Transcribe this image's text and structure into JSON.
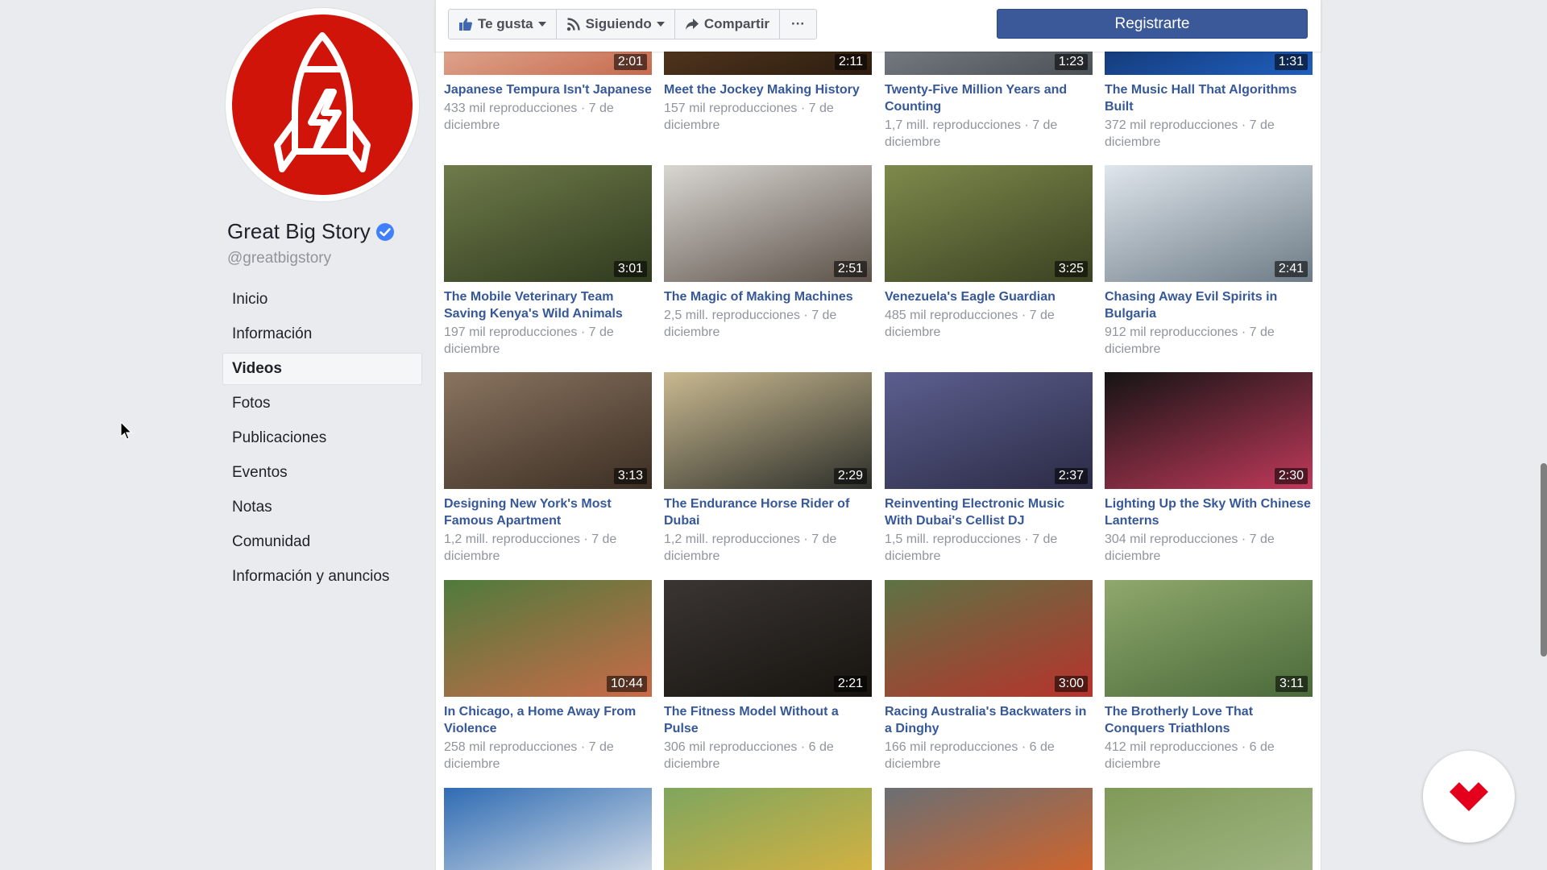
{
  "page": {
    "name": "Great Big Story",
    "handle": "@greatbigstory"
  },
  "nav": {
    "items": [
      {
        "label": "Inicio"
      },
      {
        "label": "Información"
      },
      {
        "label": "Videos",
        "active": true
      },
      {
        "label": "Fotos"
      },
      {
        "label": "Publicaciones"
      },
      {
        "label": "Eventos"
      },
      {
        "label": "Notas"
      },
      {
        "label": "Comunidad"
      },
      {
        "label": "Información y anuncios"
      }
    ]
  },
  "toolbar": {
    "like_label": "Te gusta",
    "following_label": "Siguiendo",
    "share_label": "Compartir",
    "more_label": "···",
    "register_label": "Registrarte"
  },
  "videos": [
    {
      "title": "Japanese Tempura Isn't Japanese",
      "views": "433 mil reproducciones · 7 de diciembre",
      "duration": "2:01"
    },
    {
      "title": "Meet the Jockey Making History",
      "views": "157 mil reproducciones · 7 de diciembre",
      "duration": "2:11"
    },
    {
      "title": "Twenty-Five Million Years and Counting",
      "views": "1,7 mill. reproducciones · 7 de diciembre",
      "duration": "1:23"
    },
    {
      "title": "The Music Hall That Algorithms Built",
      "views": "372 mil reproducciones · 7 de diciembre",
      "duration": "1:31"
    },
    {
      "title": "The Mobile Veterinary Team Saving Kenya's Wild Animals",
      "views": "197 mil reproducciones · 7 de diciembre",
      "duration": "3:01"
    },
    {
      "title": "The Magic of Making Machines",
      "views": "2,5 mill. reproducciones · 7 de diciembre",
      "duration": "2:51"
    },
    {
      "title": "Venezuela's Eagle Guardian",
      "views": "485 mil reproducciones · 7 de diciembre",
      "duration": "3:25"
    },
    {
      "title": "Chasing Away Evil Spirits in Bulgaria",
      "views": "912 mil reproducciones · 7 de diciembre",
      "duration": "2:41"
    },
    {
      "title": "Designing New York's Most Famous Apartment",
      "views": "1,2 mill. reproducciones · 7 de diciembre",
      "duration": "3:13"
    },
    {
      "title": "The Endurance Horse Rider of Dubai",
      "views": "1,2 mill. reproducciones · 7 de diciembre",
      "duration": "2:29"
    },
    {
      "title": "Reinventing Electronic Music With Dubai's Cellist DJ",
      "views": "1,5 mill. reproducciones · 7 de diciembre",
      "duration": "2:37"
    },
    {
      "title": "Lighting Up the Sky With Chinese Lanterns",
      "views": "304 mil reproducciones · 7 de diciembre",
      "duration": "2:30"
    },
    {
      "title": "In Chicago, a Home Away From Violence",
      "views": "258 mil reproducciones · 7 de diciembre",
      "duration": "10:44"
    },
    {
      "title": "The Fitness Model Without a Pulse",
      "views": "306 mil reproducciones · 6 de diciembre",
      "duration": "2:21"
    },
    {
      "title": "Racing Australia's Backwaters in a Dinghy",
      "views": "166 mil reproducciones · 6 de diciembre",
      "duration": "3:00"
    },
    {
      "title": "The Brotherly Love That Conquers Triathlons",
      "views": "412 mil reproducciones · 6 de diciembre",
      "duration": "3:11"
    },
    {
      "title": "",
      "views": "",
      "duration": ""
    },
    {
      "title": "",
      "views": "",
      "duration": ""
    },
    {
      "title": "",
      "views": "",
      "duration": ""
    },
    {
      "title": "",
      "views": "",
      "duration": ""
    }
  ],
  "colors": {
    "brand_red": "#d0140a",
    "link_blue": "#365899",
    "register_blue": "#3b5998",
    "verified_blue": "#4080ff"
  }
}
